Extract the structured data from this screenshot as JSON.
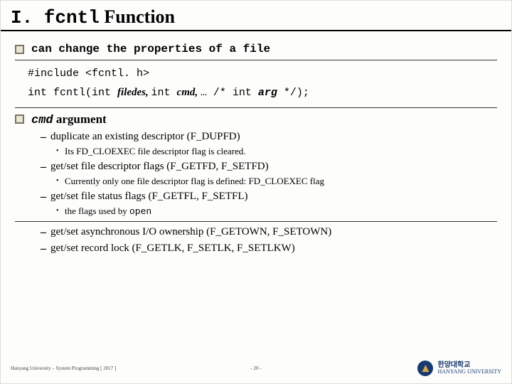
{
  "title": {
    "prefix": "I. fcntl",
    "suffix": " Function"
  },
  "bullets": {
    "b1": "can change the properties of a file",
    "b2_code": "cmd",
    "b2_suffix": " argument"
  },
  "box": {
    "include": "#include <fcntl. h>",
    "sig1": "int fcntl(int ",
    "sig2": "filedes, ",
    "sig3": "int ",
    "sig4": "cmd, ",
    "sig5": "… /* int ",
    "sig6": "arg ",
    "sig7": "*/);"
  },
  "items": {
    "d1": "duplicate an existing descriptor (F_DUPFD)",
    "d1_1": "Its FD_CLOEXEC file descriptor flag is cleared.",
    "d2": "get/set file descriptor flags (F_GETFD, F_SETFD)",
    "d2_1": "Currently only one file descriptor flag is defined: FD_CLOEXEC flag",
    "d3": "get/set file status flags (F_GETFL, F_SETFL)",
    "d3_1a": "the flags used by ",
    "d3_1b": "open",
    "d4": "get/set asynchronous I/O ownership (F_GETOWN, F_SETOWN)",
    "d5": "get/set record lock (F_GETLK, F_SETLK, F_SETLKW)"
  },
  "footer": {
    "left": "Hanyang University – System Programming [ 2017 ]",
    "center": "- 20 -",
    "uni_kr": "한양대학교",
    "uni_en": "HANYANG UNIVERSITY"
  }
}
